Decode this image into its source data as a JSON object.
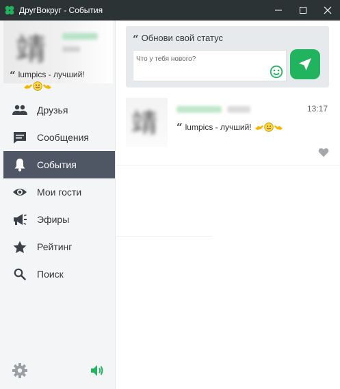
{
  "window": {
    "title": "ДругВокруг - События"
  },
  "sidebar": {
    "status_text": "lumpics - лучший!",
    "items": [
      {
        "label": "Друзья",
        "icon": "people-icon"
      },
      {
        "label": "Сообщения",
        "icon": "chat-icon"
      },
      {
        "label": "События",
        "icon": "bell-icon",
        "active": true
      },
      {
        "label": "Мои гости",
        "icon": "eye-icon"
      },
      {
        "label": "Эфиры",
        "icon": "megaphone-icon"
      },
      {
        "label": "Рейтинг",
        "icon": "star-icon"
      },
      {
        "label": "Поиск",
        "icon": "search-icon"
      }
    ]
  },
  "status_update": {
    "title": "Обнови свой статус",
    "placeholder": "Что у тебя нового?"
  },
  "event": {
    "time": "13:17",
    "text": "lumpics - лучший!"
  },
  "colors": {
    "accent": "#21b35e",
    "titlebar": "#2c3335",
    "sidebar_active": "#4e5763",
    "sidebar_bg": "#f4f5f6"
  }
}
